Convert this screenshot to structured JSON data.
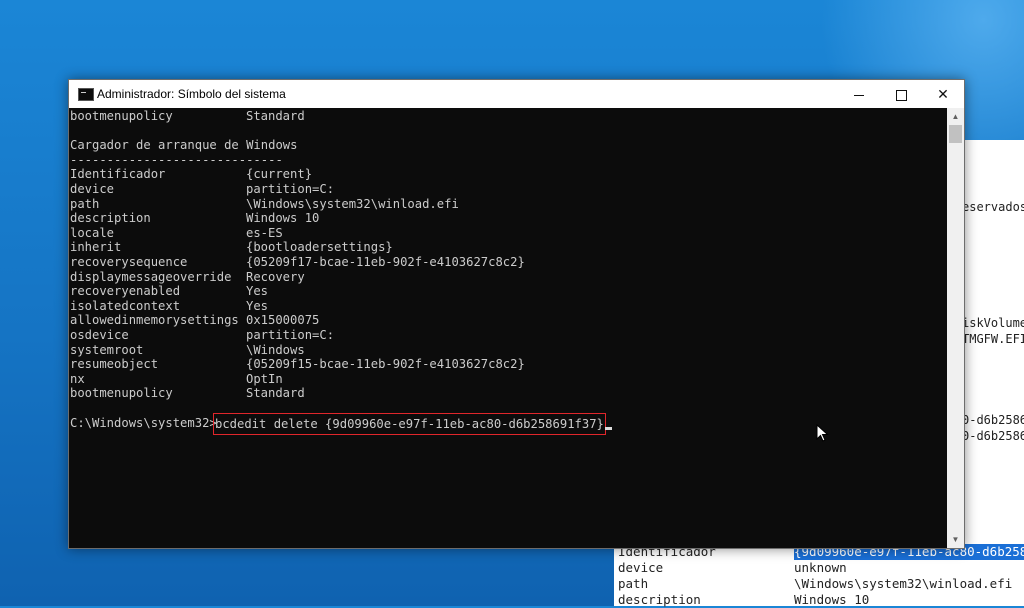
{
  "window": {
    "title": "Administrador: Símbolo del sistema",
    "minimize_icon": "minimize-icon",
    "maximize_icon": "maximize-icon",
    "close_icon": "close-icon",
    "close_glyph": "✕"
  },
  "console": {
    "lines": [
      {
        "k": "bootmenupolicy",
        "v": "Standard"
      },
      {
        "k": "",
        "v": ""
      },
      {
        "k": "Cargador de arranque de Windows",
        "v": ""
      },
      {
        "k": "-----------------------------",
        "v": ""
      },
      {
        "k": "Identificador",
        "v": "{current}"
      },
      {
        "k": "device",
        "v": "partition=C:"
      },
      {
        "k": "path",
        "v": "\\Windows\\system32\\winload.efi"
      },
      {
        "k": "description",
        "v": "Windows 10"
      },
      {
        "k": "locale",
        "v": "es-ES"
      },
      {
        "k": "inherit",
        "v": "{bootloadersettings}"
      },
      {
        "k": "recoverysequence",
        "v": "{05209f17-bcae-11eb-902f-e4103627c8c2}"
      },
      {
        "k": "displaymessageoverride",
        "v": "Recovery"
      },
      {
        "k": "recoveryenabled",
        "v": "Yes"
      },
      {
        "k": "isolatedcontext",
        "v": "Yes"
      },
      {
        "k": "allowedinmemorysettings",
        "v": "0x15000075"
      },
      {
        "k": "osdevice",
        "v": "partition=C:"
      },
      {
        "k": "systemroot",
        "v": "\\Windows"
      },
      {
        "k": "resumeobject",
        "v": "{05209f15-bcae-11eb-902f-e4103627c8c2}"
      },
      {
        "k": "nx",
        "v": "OptIn"
      },
      {
        "k": "bootmenupolicy",
        "v": "Standard"
      }
    ],
    "prompt": "C:\\Windows\\system32>",
    "command": "bcdedit delete {9d09960e-e97f-11eb-ac80-d6b258691f37}"
  },
  "background_window": {
    "fragments": [
      "eservados",
      "iskVolume",
      "TMGFW.EFI",
      "0-d6b2586",
      "0-d6b2586"
    ]
  },
  "background_lower": {
    "rows": [
      {
        "k": "Identificador",
        "v": "{9d09960e-e97f-11eb-ac80-d6b2586"
      },
      {
        "k": "device",
        "v": "unknown"
      },
      {
        "k": "path",
        "v": "\\Windows\\system32\\winload.efi"
      },
      {
        "k": "description",
        "v": "Windows 10"
      }
    ]
  },
  "colors": {
    "highlight_border": "#e0262b",
    "selection": "#1a6fd6",
    "console_bg": "#0c0c0c",
    "console_text": "#cccccc"
  }
}
